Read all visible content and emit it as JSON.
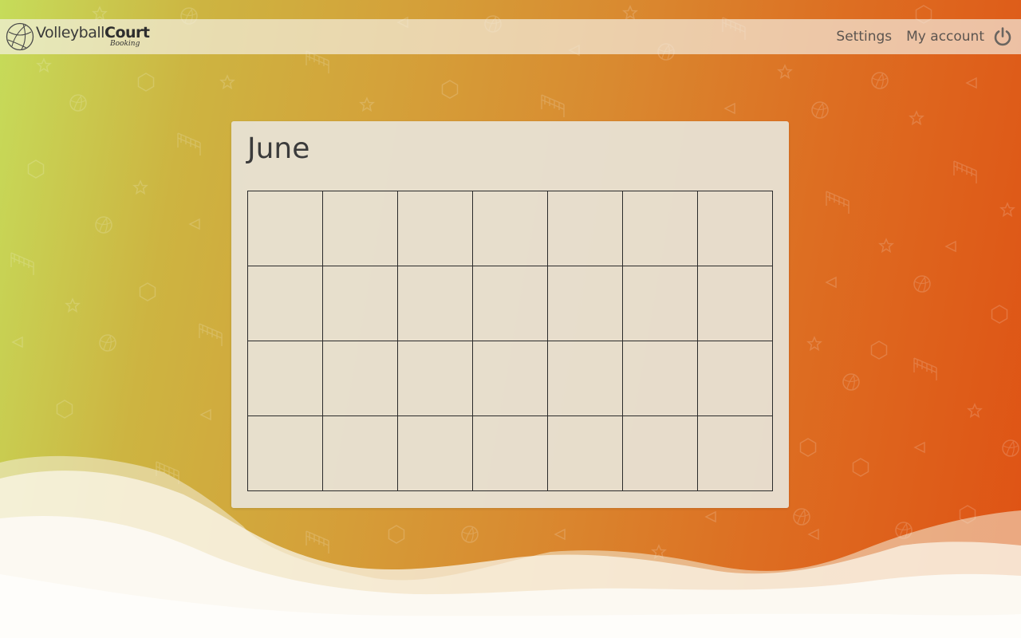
{
  "app": {
    "logo": {
      "word_light": "Volleyball",
      "word_bold": "Court",
      "subtitle": "Booking",
      "icon": "volleyball-icon"
    }
  },
  "nav": {
    "settings_label": "Settings",
    "account_label": "My account",
    "logout_icon": "power-icon"
  },
  "calendar": {
    "month": "June",
    "weeks": [
      [
        "",
        "",
        "",
        "",
        "",
        "",
        ""
      ],
      [
        "",
        "",
        "",
        "",
        "",
        "",
        ""
      ],
      [
        "",
        "",
        "",
        "",
        "",
        "",
        ""
      ],
      [
        "",
        "",
        "",
        "",
        "",
        "",
        ""
      ]
    ]
  },
  "colors": {
    "gradient_left": "#c6dc5a",
    "gradient_mid": "#d4a23a",
    "gradient_right": "#df5214",
    "card_background": "#e8e2d6",
    "text": "#3b3b3b"
  }
}
